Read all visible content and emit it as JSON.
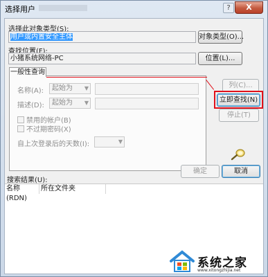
{
  "window": {
    "title": "选择用户",
    "help_glyph": "?",
    "close_glyph": "X"
  },
  "object_type": {
    "label": "选择此对象类型(S):",
    "value": "用户或内置安全主体",
    "button": "对象类型(O)..."
  },
  "location": {
    "label": "查找位置(F):",
    "value": "小猪系统网络-PC",
    "button": "位置(L)..."
  },
  "tab": {
    "label": "一般性查询"
  },
  "query": {
    "name": {
      "label": "名称(A):",
      "mode": "起始为",
      "value": ""
    },
    "description": {
      "label": "描述(D):",
      "mode": "起始为",
      "value": ""
    },
    "disabled_accounts": "禁用的帐户(B)",
    "no_expire_password": "不过期密码(X)",
    "days_since_login": {
      "label": "自上次登录后的天数(I):",
      "value": ""
    }
  },
  "side_buttons": {
    "columns": "列(C)...",
    "find_now": "立即查找(N)",
    "stop": "停止(T)"
  },
  "results": {
    "label": "搜索结果(U):",
    "columns": [
      "名称(RDN)",
      "所在文件夹"
    ]
  },
  "footer": {
    "ok": "确定",
    "cancel": "取消"
  },
  "watermark": {
    "text": "系统之家",
    "url": "www.xitongzhijia.net"
  },
  "colors": {
    "highlight": "#e0101a",
    "selection": "#3399ff",
    "close_button": "#c45b3f"
  }
}
